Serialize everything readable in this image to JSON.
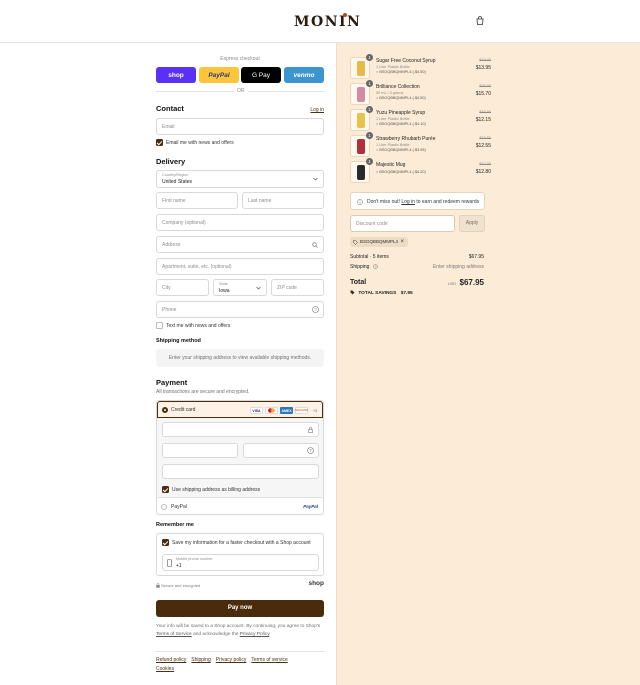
{
  "header": {
    "brand": "MONIN",
    "cart_icon": "shopping-bag-icon"
  },
  "express": {
    "title": "Express checkout",
    "buttons": {
      "shop": "shop",
      "paypal": "PayPal",
      "gpay": "G Pay",
      "venmo": "venmo"
    },
    "or": "OR"
  },
  "contact": {
    "heading": "Contact",
    "login": "Log in",
    "email_placeholder": "Email",
    "news_label": "Email me with news and offers"
  },
  "delivery": {
    "heading": "Delivery",
    "country_label": "Country/Region",
    "country_value": "United States",
    "first_name": "First name",
    "last_name": "Last name",
    "company": "Company (optional)",
    "address": "Address",
    "apartment": "Apartment, suite, etc. (optional)",
    "city": "City",
    "state_label": "State",
    "state_value": "Iowa",
    "zip": "ZIP code",
    "phone": "Phone",
    "text_label": "Text me with news and offers"
  },
  "shipping": {
    "heading": "Shipping method",
    "note": "Enter your shipping address to view available shipping methods."
  },
  "payment": {
    "heading": "Payment",
    "subtext": "All transactions are secure and encrypted.",
    "credit_card": "Credit card",
    "card_brands": {
      "visa": "VISA",
      "mc": "MC",
      "amex": "AMEX",
      "discover": "DISCOVER",
      "more": "+3"
    },
    "billing_label": "Use shipping address as billing address",
    "paypal": "PayPal",
    "paypal_logo": "PayPal"
  },
  "remember": {
    "heading": "Remember me",
    "save_label": "Save my information for a faster checkout with a Shop account",
    "phone_label": "Mobile phone number",
    "phone_value": "+1",
    "secure": "Secure and encrypted",
    "shop": "shop"
  },
  "pay_now": "Pay now",
  "legal": {
    "text1": "Your info will be saved to a Shop account. By continuing, you agree to Shop's",
    "terms": "Terms of Service",
    "text2": "and acknowledge the",
    "privacy": "Privacy Policy",
    "end": "."
  },
  "footer": [
    "Refund policy",
    "Shipping",
    "Privacy policy",
    "Terms of service",
    "Cookies"
  ],
  "summary": {
    "items": [
      {
        "qty": "1",
        "name": "Sugar Free Coconut Syrup",
        "variant": "1 Liter Plastic Bottle",
        "discount": "BSGQBBQMMPL4 (-$4.50)",
        "orig": "$18.00",
        "price": "$13.95",
        "color": "#e7b84a"
      },
      {
        "qty": "1",
        "name": "Brilliance Collection",
        "variant": "50 mL / 3 grams",
        "discount": "BSGQBBQMMPL4 (-$4.50)",
        "orig": "$20.00",
        "price": "$15.70",
        "color": "#d48aa5"
      },
      {
        "qty": "1",
        "name": "Yuzu Pineapple Syrup",
        "variant": "1 Liter Plastic Bottle",
        "discount": "BSGQBBQMMPL4 (-$4.10)",
        "orig": "$16.50",
        "price": "$12.15",
        "color": "#e8c24a"
      },
      {
        "qty": "1",
        "name": "Strawberry Rhubarb Purée",
        "variant": "1 Liter Plastic Bottle",
        "discount": "BSGQBBQMMPL4 (-$3.95)",
        "orig": "$16.50",
        "price": "$12.55",
        "color": "#b3303a"
      },
      {
        "qty": "1",
        "name": "Majestic Mug",
        "variant": "",
        "discount": "BSGQBBQMMPL4 (-$4.20)",
        "orig": "$17.00",
        "price": "$12.80",
        "color": "#2b2b2b"
      }
    ],
    "promo_pre": "Don't miss out!",
    "promo_link": "Log in",
    "promo_post": "to earn and redeem rewards",
    "discount_placeholder": "Discount code",
    "apply": "Apply",
    "applied_code": "BSGQBBQMMPL4",
    "subtotal_label": "Subtotal · 5 items",
    "subtotal_value": "$67.95",
    "shipping_label": "Shipping",
    "shipping_value": "Enter shipping address",
    "total_label": "Total",
    "currency": "USD",
    "total_value": "$67.95",
    "savings_label": "TOTAL SAVINGS",
    "savings_value": "$7.95"
  }
}
